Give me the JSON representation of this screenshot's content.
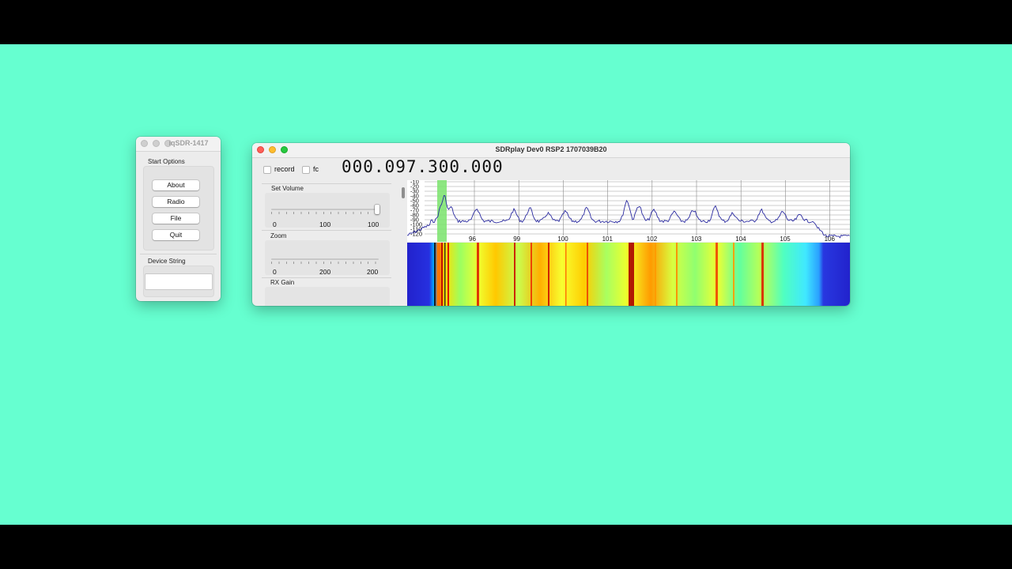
{
  "small_window": {
    "title": "iqSDR-1417",
    "start_options_label": "Start Options",
    "buttons": [
      "About",
      "Radio",
      "File",
      "Quit"
    ],
    "device_string_label": "Device String",
    "device_string_value": ""
  },
  "main_window": {
    "title": "SDRplay Dev0 RSP2 1707039B20",
    "record_label": "record",
    "fc_label": "fc",
    "frequency": "000.097.300.000",
    "volume": {
      "label": "Set Volume",
      "min": "0",
      "mid": "100",
      "value": "100"
    },
    "zoom": {
      "label": "Zoom",
      "min": "0",
      "mid": "200",
      "value": "200"
    },
    "rx_gain": {
      "label": "RX Gain"
    }
  },
  "spectrum": {
    "y_ticks": [
      "-10",
      "-20",
      "-30",
      "-40",
      "-50",
      "-60",
      "-70",
      "-80",
      "-90",
      "-100",
      "-110",
      "-120"
    ],
    "x_ticks": [
      "96",
      "99",
      "100",
      "101",
      "102",
      "103",
      "104",
      "105",
      "106"
    ],
    "grid": true,
    "trace_color": "#2a2aa0",
    "highlight_color": "#79e36b"
  },
  "colors": {
    "desktop": "#66ffd0",
    "waterfall_base": "#00d8ff"
  }
}
